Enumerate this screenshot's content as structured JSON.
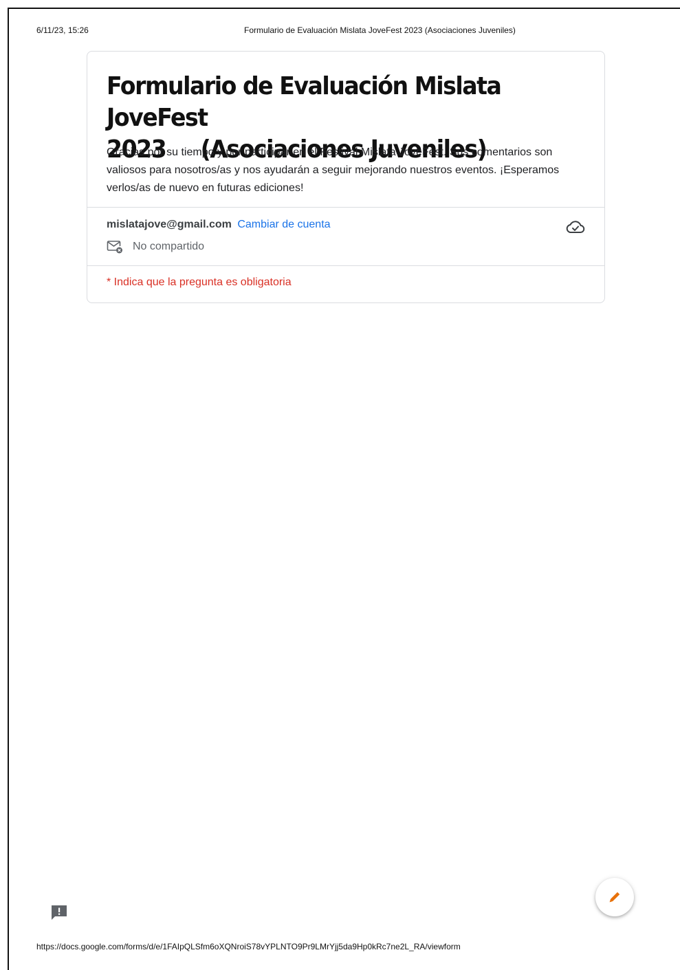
{
  "print_header": {
    "date": "6/11/23, 15:26",
    "title": "Formulario de Evaluación Mislata JoveFest 2023 (Asociaciones Juveniles)"
  },
  "form": {
    "title": "Formulario de Evaluación Mislata JoveFest\n2023     (Asociaciones Juveniles)",
    "description": "Gracias por su tiempo y por participar en el Festival Mislata JoveFest. Sus comentarios son valiosos para nosotros/as y nos ayudarán a seguir mejorando nuestros eventos. ¡Esperamos verlos/as de nuevo en futuras ediciones!",
    "account_email": "mislatajove@gmail.com",
    "switch_account_label": "Cambiar de cuenta",
    "share_status": "No compartido",
    "required_note": "* Indica que la pregunta es obligatoria"
  },
  "icons": {
    "cloud": "cloud-saved-icon",
    "share": "mail-not-shared-icon",
    "edit": "pencil-icon",
    "feedback": "feedback-icon"
  },
  "colors": {
    "link": "#1a73e8",
    "required": "#d93025",
    "edit_accent": "#e8710a"
  },
  "print_footer": {
    "url": "https://docs.google.com/forms/d/e/1FAIpQLSfm6oXQNroiS78vYPLNTO9Pr9LMrYjj5da9Hp0kRc7ne2L_RA/viewform"
  }
}
